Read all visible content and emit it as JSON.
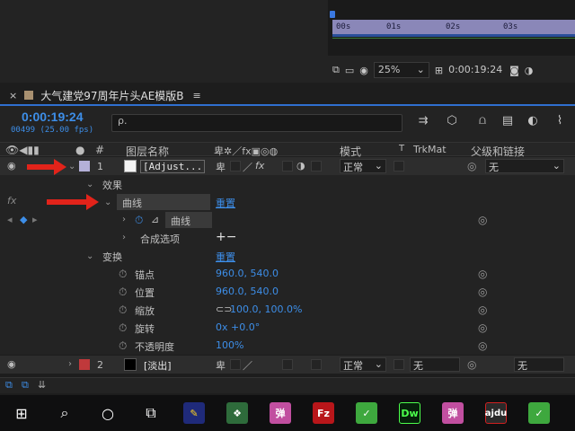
{
  "comp": {
    "ruler_ticks": [
      "00s",
      "01s",
      "02s",
      "03s"
    ],
    "zoom": "25%",
    "timecode": "0:00:19:24"
  },
  "panel": {
    "close": "×",
    "title": "大气建党97周年片头AE模版B",
    "menu": "≡"
  },
  "time": {
    "current": "0:00:19:24",
    "fps": "00499 (25.00 fps)",
    "search_placeholder": "ρ."
  },
  "columns": {
    "num": "#",
    "layer_name": "图层名称",
    "mode": "模式",
    "t": "T",
    "trkmat": "TrkMat",
    "parent": "父级和链接"
  },
  "layers": [
    {
      "num": "1",
      "name": "[Adjust...",
      "mode": "正常",
      "parent": "无",
      "label_color": "#b4b0d8"
    },
    {
      "num": "2",
      "name": "[淡出]",
      "mode": "正常",
      "trkmat": "无",
      "parent": "无",
      "label_color": "#c0393b"
    }
  ],
  "props": {
    "effects": "效果",
    "curves": "曲线",
    "reset1": "重置",
    "curves_sub": "曲线",
    "compositing": "合成选项",
    "plus_minus": "+−",
    "transform": "变换",
    "reset2": "重置",
    "anchor": "锚点",
    "anchor_val": "960.0, 540.0",
    "position": "位置",
    "position_val": "960.0, 540.0",
    "scale": "缩放",
    "scale_val": "100.0, 100.0%",
    "rotation": "旋转",
    "rotation_val": "0x +0.0°",
    "opacity": "不透明度",
    "opacity_val": "100%",
    "fx": "fx"
  },
  "colors": {
    "accent_blue": "#3d8ee8",
    "arrow_red": "#e2231a"
  },
  "taskbar": {
    "apps": [
      "windows-start",
      "search",
      "cortana",
      "task-view",
      "app-feather",
      "app-green",
      "app-pink-弹",
      "filezilla",
      "app-green-2",
      "dreamweaver",
      "app-pink-弹-2",
      "app-red",
      "app-green-3"
    ],
    "dan": "弹",
    "fz": "Fz",
    "dw": "Dw",
    "watermark": "ajdu"
  }
}
